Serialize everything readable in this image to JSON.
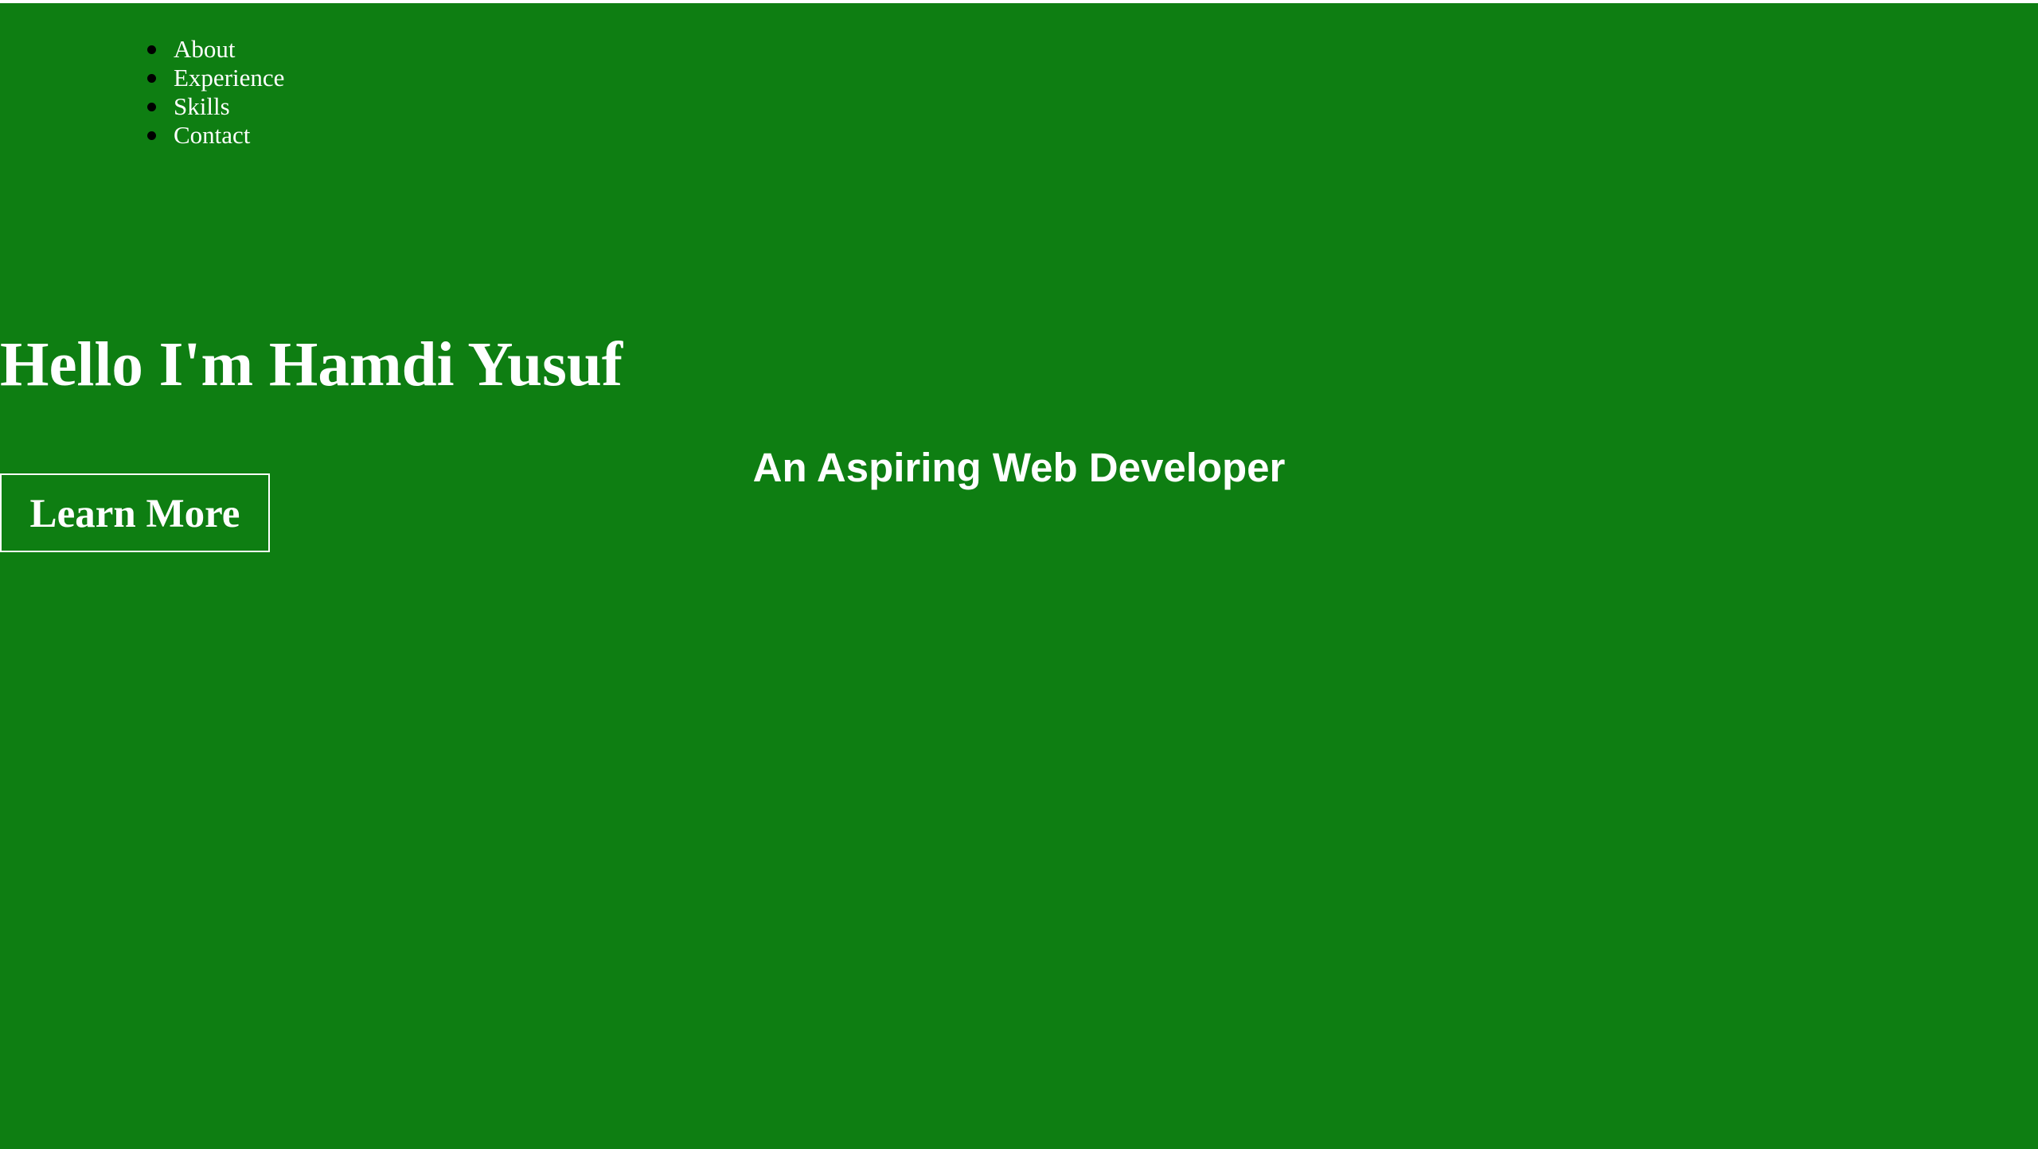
{
  "colors": {
    "background": "#0e7e12",
    "text": "#ffffff",
    "bullet": "#000000"
  },
  "nav": {
    "items": [
      {
        "label": "About"
      },
      {
        "label": "Experience"
      },
      {
        "label": "Skills"
      },
      {
        "label": "Contact"
      }
    ]
  },
  "hero": {
    "headline": "Hello I'm Hamdi Yusuf",
    "subheadline": "An Aspiring Web Developer",
    "button_label": "Learn More"
  }
}
